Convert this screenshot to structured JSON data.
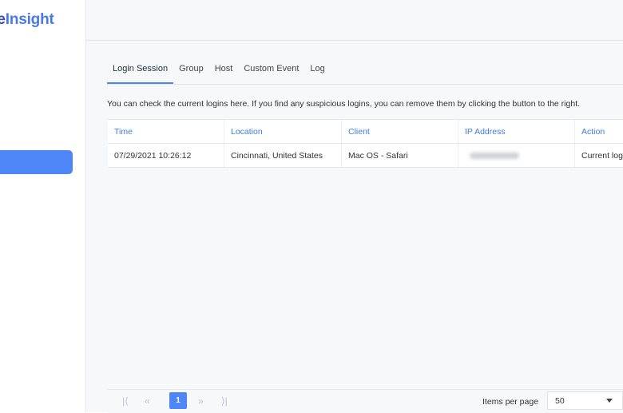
{
  "sidebar": {
    "logo_part1": "ve",
    "logo_part2": "Insight"
  },
  "tabs": [
    {
      "label": "Login Session",
      "active": true
    },
    {
      "label": "Group"
    },
    {
      "label": "Host"
    },
    {
      "label": "Custom Event"
    },
    {
      "label": "Log"
    }
  ],
  "description": "You can check the current logins here. If you find any suspicious logins, you can remove them by clicking the button to the right.",
  "table": {
    "columns": [
      "Time",
      "Location",
      "Client",
      "IP Address",
      "Action"
    ],
    "rows": [
      {
        "time": "07/29/2021 10:26:12",
        "location": "Cincinnati, United States",
        "client": "Mac OS - Safari",
        "ip": "",
        "action": "Current log"
      }
    ]
  },
  "pagination": {
    "current_page": "1",
    "items_per_page_label": "Items per page",
    "items_per_page_value": "50",
    "icons": [
      "first-page-icon",
      "prev-page-icon",
      "next-page-icon",
      "last-page-icon"
    ]
  },
  "colors": {
    "accent": "#4f86f7",
    "header_text": "#3d7be0"
  }
}
